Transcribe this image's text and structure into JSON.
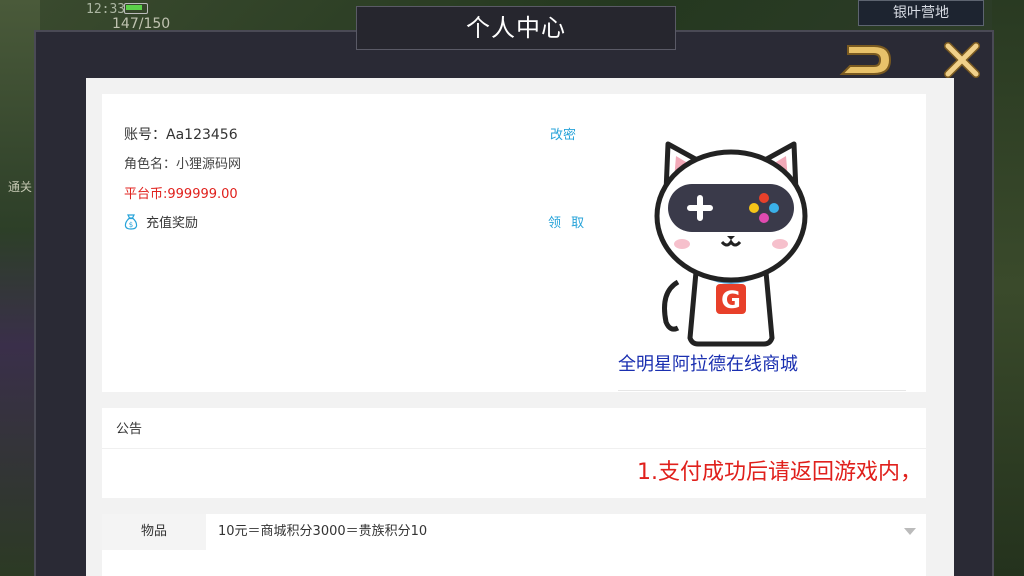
{
  "hud": {
    "time": "12:33",
    "stamina": "147/150",
    "map_label": "银叶营地",
    "map_arrow": ">",
    "pass_label": "通关"
  },
  "dialog": {
    "title": "个人中心"
  },
  "profile": {
    "account": "账号：Aa123456",
    "change_password": "改密",
    "role_name": "角色名：小狸源码网",
    "platform_coins": "平台币:999999.00",
    "recharge_reward": "充值奖励",
    "claim": "领 取",
    "mascot_letter": "G",
    "mall_name": "全明星阿拉德在线商城"
  },
  "notice": {
    "title": "公告",
    "text": "1.支付成功后请返回游戏内，"
  },
  "item": {
    "label": "物品",
    "selected": "10元＝商城积分3000＝贵族积分10"
  },
  "colors": {
    "link": "#27a3d9",
    "highlight_red": "#e0201c",
    "mall_name_blue": "#1a2fb0",
    "gold_icon": "#e8c26a"
  }
}
